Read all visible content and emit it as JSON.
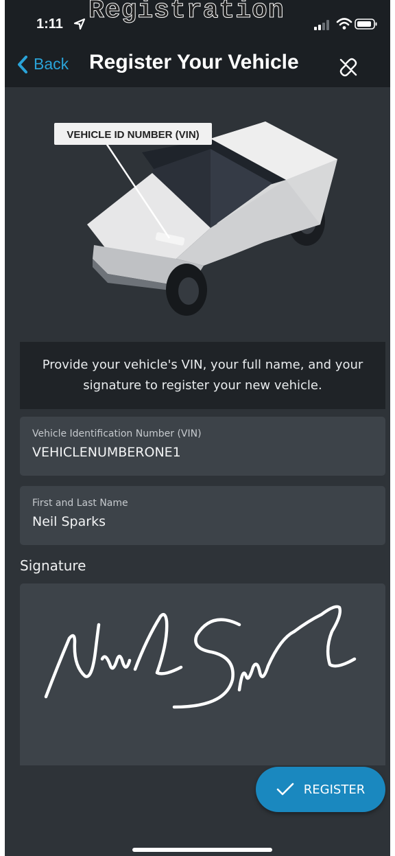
{
  "status_bar": {
    "time": "1:11"
  },
  "overlay_title": "Registration",
  "nav": {
    "back_label": "Back",
    "title": "Register Your Vehicle"
  },
  "hero": {
    "callout_label": "VEHICLE ID NUMBER (VIN)"
  },
  "info_text": "Provide your vehicle's VIN, your full name, and your signature to register your new vehicle.",
  "form": {
    "vin": {
      "label": "Vehicle Identification Number (VIN)",
      "value": "VEHICLENUMBERONE1"
    },
    "name": {
      "label": "First and Last Name",
      "value": "Neil Sparks"
    },
    "signature_label": "Signature"
  },
  "register_button": {
    "label": "REGISTER"
  },
  "colors": {
    "accent": "#2aa3d8",
    "button": "#1a88bf",
    "background": "#2e3338",
    "header": "#1b1f23",
    "field": "#3d4349"
  }
}
